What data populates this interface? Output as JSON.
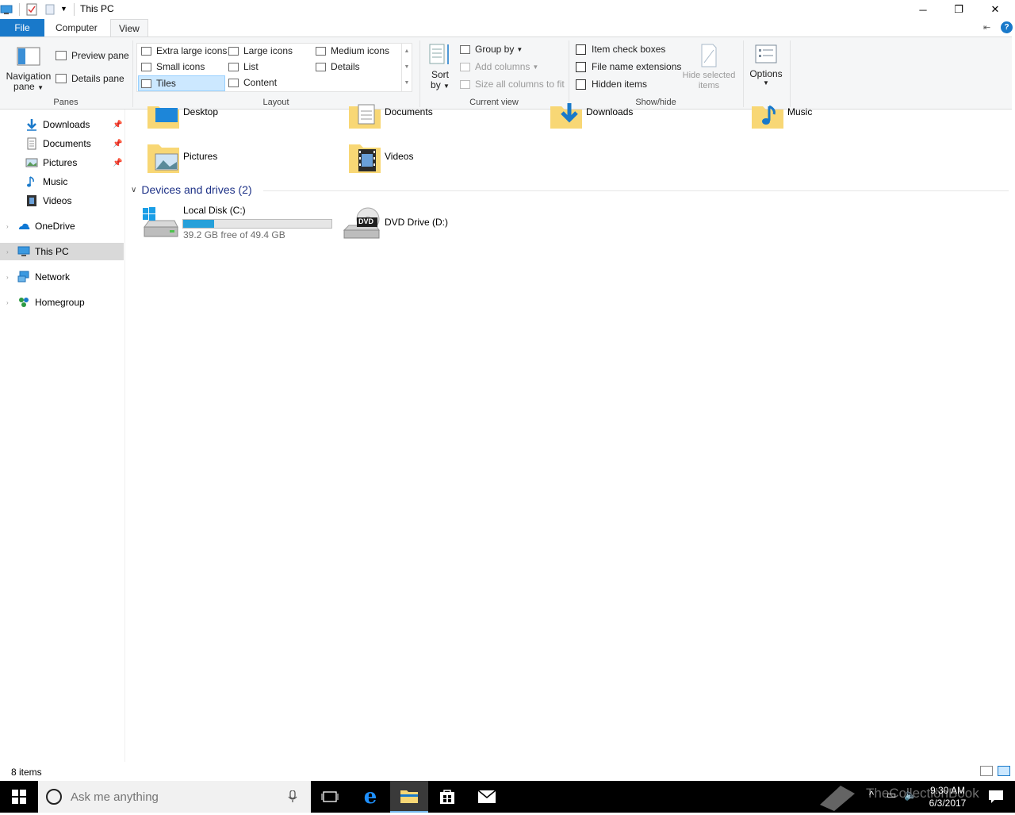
{
  "window": {
    "title": "This PC",
    "minimize_glyph": "─",
    "restore_glyph": "❐",
    "close_glyph": "✕"
  },
  "tabs": {
    "file": "File",
    "computer": "Computer",
    "view": "View"
  },
  "ribbon": {
    "panes": {
      "label": "Panes",
      "navigation_pane_line1": "Navigation",
      "navigation_pane_line2": "pane",
      "preview_pane": "Preview pane",
      "details_pane": "Details pane"
    },
    "layout": {
      "label": "Layout",
      "extra_large_icons": "Extra large icons",
      "large_icons": "Large icons",
      "medium_icons": "Medium icons",
      "small_icons": "Small icons",
      "list": "List",
      "details": "Details",
      "tiles": "Tiles",
      "content": "Content"
    },
    "current_view": {
      "label": "Current view",
      "sort_line1": "Sort",
      "sort_line2": "by",
      "group_by": "Group by",
      "add_columns": "Add columns",
      "size_all_columns": "Size all columns to fit"
    },
    "show_hide": {
      "label": "Show/hide",
      "item_check_boxes": "Item check boxes",
      "file_name_extensions": "File name extensions",
      "hidden_items": "Hidden items",
      "hide_selected_line1": "Hide selected",
      "hide_selected_line2": "items"
    },
    "options": "Options"
  },
  "nav": {
    "quick_access": [
      {
        "label": "Downloads"
      },
      {
        "label": "Documents"
      },
      {
        "label": "Pictures"
      },
      {
        "label": "Music"
      },
      {
        "label": "Videos"
      }
    ],
    "onedrive": "OneDrive",
    "this_pc": "This PC",
    "network": "Network",
    "homegroup": "Homegroup"
  },
  "folders": {
    "desktop": "Desktop",
    "documents": "Documents",
    "downloads": "Downloads",
    "music": "Music",
    "pictures": "Pictures",
    "videos": "Videos"
  },
  "devices": {
    "header": "Devices and drives (2)",
    "local_disk": {
      "name": "Local Disk (C:)",
      "free_text": "39.2 GB free of 49.4 GB",
      "used_fraction": 0.206
    },
    "dvd": {
      "name": "DVD Drive (D:)",
      "badge": "DVD"
    }
  },
  "status": {
    "items": "8 items"
  },
  "taskbar": {
    "search_placeholder": "Ask me anything",
    "time": "9:30 AM",
    "date": "6/3/2017",
    "watermark": "TheCollectionBook"
  },
  "colors": {
    "accent": "#1979ca",
    "progress": "#26a0da",
    "folder": "#f8d775",
    "group_header": "#1e3287"
  }
}
